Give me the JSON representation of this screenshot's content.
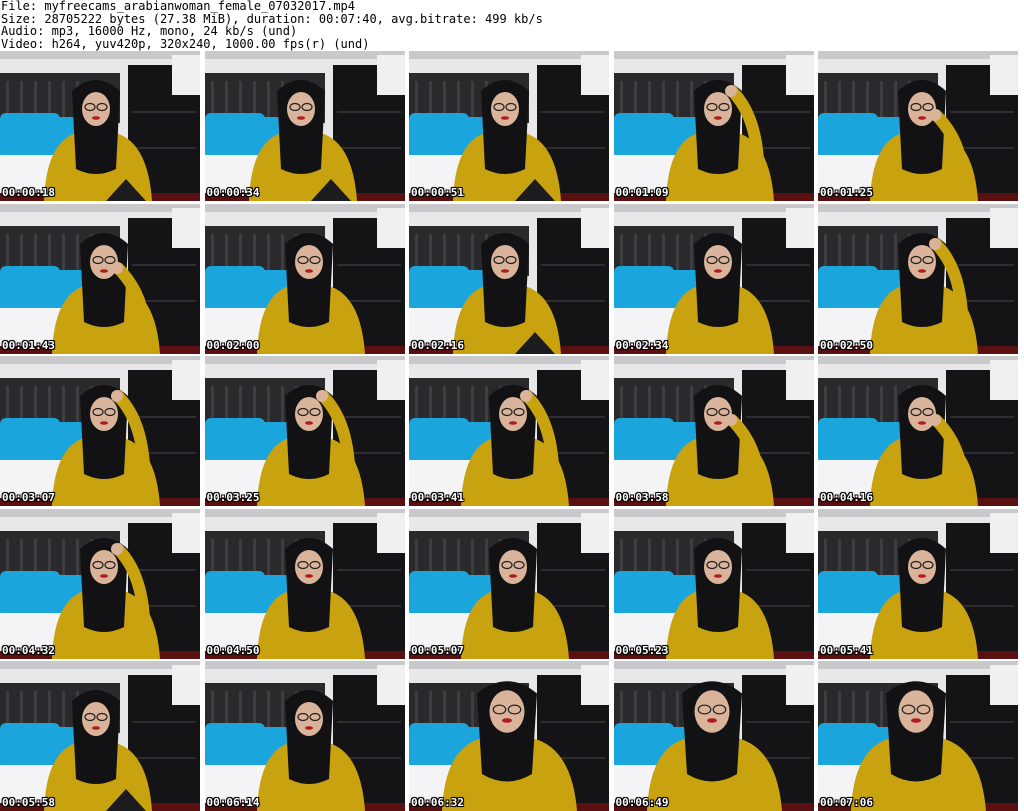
{
  "header": {
    "file_line": "File: myfreecams_arabianwoman_female_07032017.mp4",
    "size_line": "Size: 28705222 bytes (27.38 MiB), duration: 00:07:40, avg.bitrate: 499 kb/s",
    "audio_line": "Audio: mp3, 16000 Hz, mono, 24 kb/s (und)",
    "video_line": "Video: h264, yuv420p, 320x240, 1000.00 fps(r) (und)"
  },
  "colors": {
    "headboard": "#2a2a2c",
    "wall": "#e8e8ea",
    "pillow": "#1aa6dd",
    "sheet": "#f4f4f6",
    "cabinet": "#141416",
    "shirt": "#c9a20f",
    "hijab": "#121214",
    "skin": "#d9b39a",
    "floor": "#5a1010"
  },
  "frames": [
    {
      "time": "00:00:18",
      "pose": "lean"
    },
    {
      "time": "00:00:34",
      "pose": "lean"
    },
    {
      "time": "00:00:51",
      "pose": "lean"
    },
    {
      "time": "00:01:09",
      "pose": "hand-head"
    },
    {
      "time": "00:01:25",
      "pose": "hand-cheek"
    },
    {
      "time": "00:01:43",
      "pose": "hand-cheek"
    },
    {
      "time": "00:02:00",
      "pose": "front"
    },
    {
      "time": "00:02:16",
      "pose": "lean"
    },
    {
      "time": "00:02:34",
      "pose": "front"
    },
    {
      "time": "00:02:50",
      "pose": "hand-head"
    },
    {
      "time": "00:03:07",
      "pose": "hand-head"
    },
    {
      "time": "00:03:25",
      "pose": "hand-head"
    },
    {
      "time": "00:03:41",
      "pose": "hand-head"
    },
    {
      "time": "00:03:58",
      "pose": "hand-cheek"
    },
    {
      "time": "00:04:16",
      "pose": "hand-cheek"
    },
    {
      "time": "00:04:32",
      "pose": "hand-head"
    },
    {
      "time": "00:04:50",
      "pose": "front"
    },
    {
      "time": "00:05:07",
      "pose": "front"
    },
    {
      "time": "00:05:23",
      "pose": "front"
    },
    {
      "time": "00:05:41",
      "pose": "front"
    },
    {
      "time": "00:05:58",
      "pose": "lean"
    },
    {
      "time": "00:06:14",
      "pose": "front"
    },
    {
      "time": "00:06:32",
      "pose": "close"
    },
    {
      "time": "00:06:49",
      "pose": "close"
    },
    {
      "time": "00:07:06",
      "pose": "close"
    }
  ]
}
